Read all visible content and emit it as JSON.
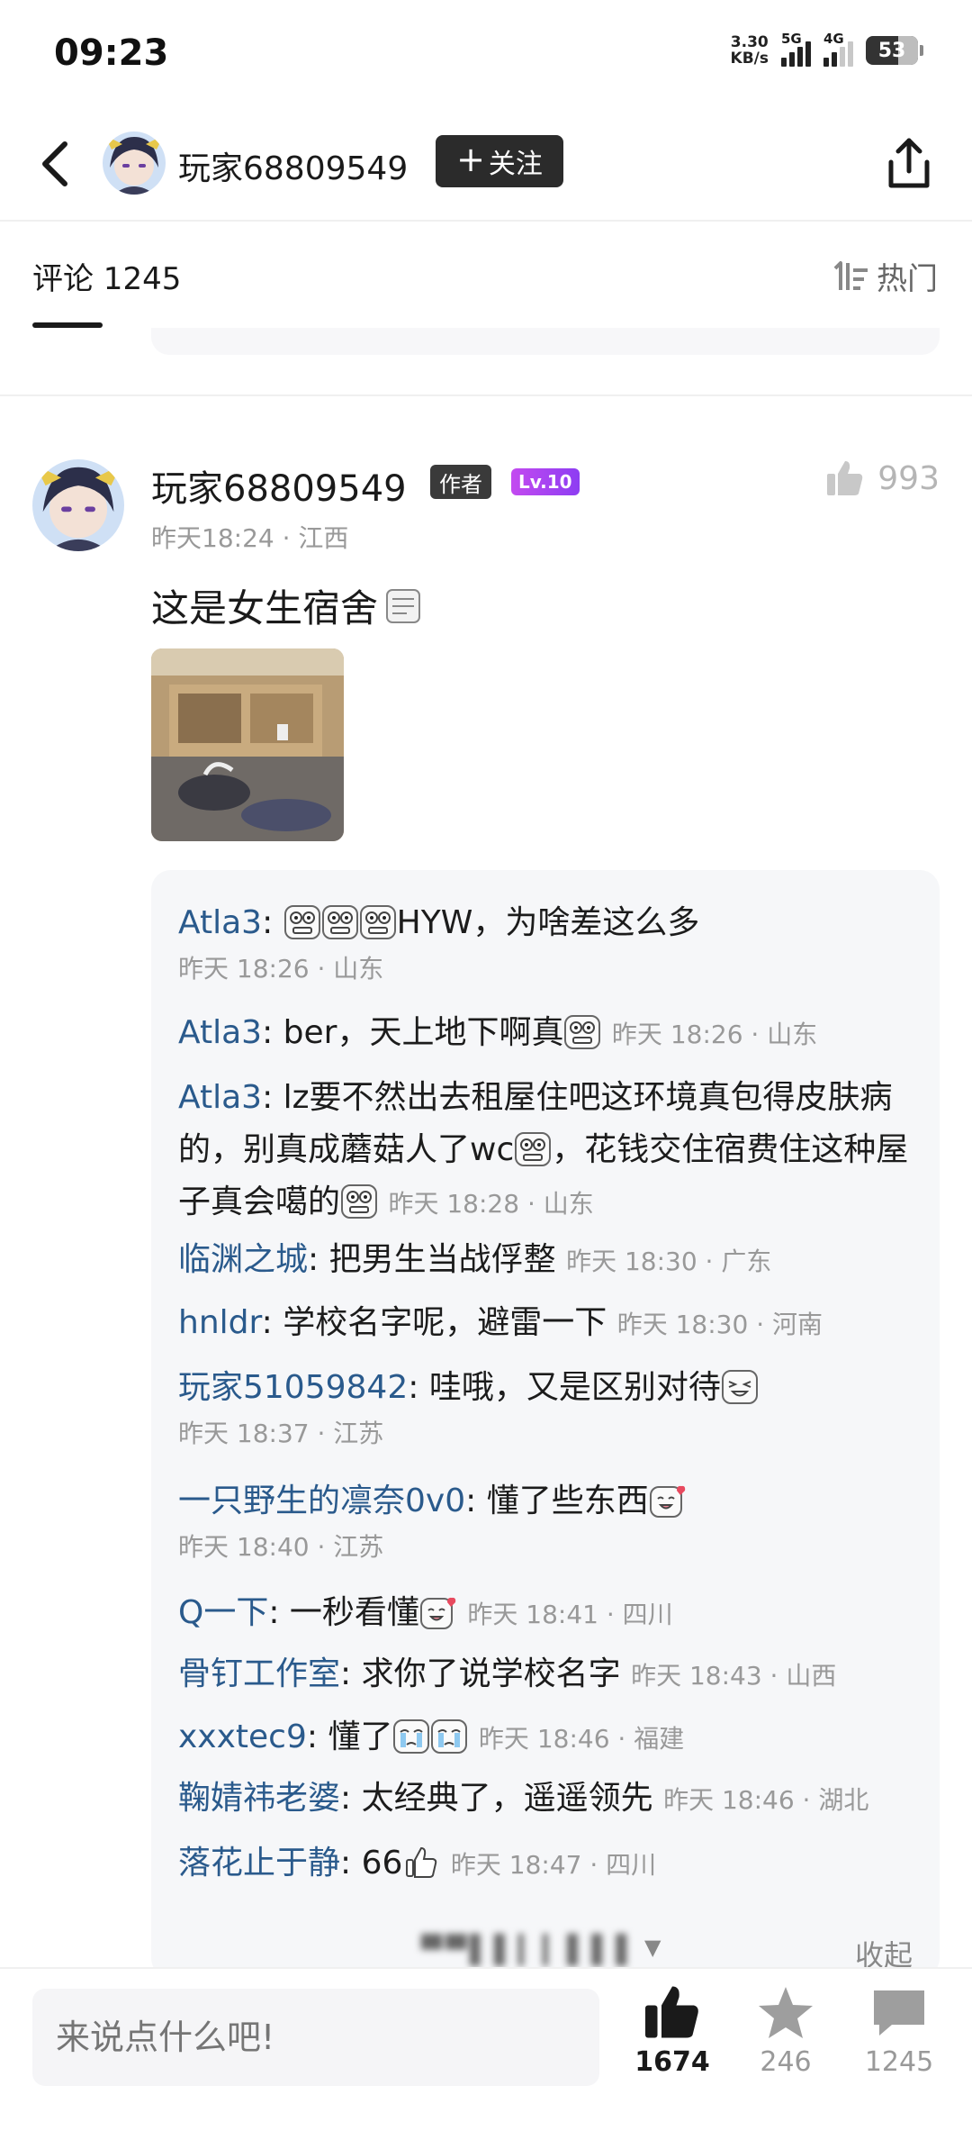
{
  "status_bar": {
    "time": "09:23",
    "net_speed_value": "3.30",
    "net_speed_unit": "KB/s",
    "sim1": "5G",
    "sim2": "4G",
    "battery": "53"
  },
  "header": {
    "username": "玩家68809549",
    "follow_label": "关注"
  },
  "tabs": {
    "comments_label": "评论 1245",
    "sort_label": "热门"
  },
  "comment": {
    "username": "玩家68809549",
    "author_badge": "作者",
    "level_badge": "Lv.10",
    "like_count": "993",
    "meta": "昨天18:24 · 江西",
    "text": "这是女生宿舍"
  },
  "replies": [
    {
      "name": "Atla3",
      "text": "HYW，为啥差这么多",
      "time": "昨天 18:26 · 山东"
    },
    {
      "name": "Atla3",
      "text": "ber，天上地下啊真",
      "time": "昨天 18:26 · 山东"
    },
    {
      "name": "Atla3",
      "text1": "lz要不然出去租屋住吧这环境真包得皮肤病的，别真成蘑菇人了wc",
      "text2": "，花钱交住宿费住这种屋子真会噶的",
      "time": "昨天 18:28 · 山东"
    },
    {
      "name": "临渊之城",
      "text": "把男生当战俘整",
      "time": "昨天 18:30 · 广东"
    },
    {
      "name": "hnldr",
      "text": "学校名字呢，避雷一下",
      "time": "昨天 18:30 · 河南"
    },
    {
      "name": "玩家51059842",
      "text": "哇哦，又是区别对待",
      "time": "昨天 18:37 · 江苏"
    },
    {
      "name": "一只野生的凛奈0v0",
      "text": "懂了些东西",
      "time": "昨天 18:40 · 江苏"
    },
    {
      "name": "Q一下",
      "text": "一秒看懂",
      "time": "昨天 18:41 · 四川"
    },
    {
      "name": "骨钉工作室",
      "text": "求你了说学校名字",
      "time": "昨天 18:43 · 山西"
    },
    {
      "name": "xxxtec9",
      "text": "懂了",
      "time": "昨天 18:46 · 福建"
    },
    {
      "name": "鞠婧祎老婆",
      "text": "太经典了，遥遥领先",
      "time": "昨天 18:46 · 湖北"
    },
    {
      "name": "落花止于静",
      "text": "66",
      "time": "昨天 18:47 · 四川"
    }
  ],
  "collapse": {
    "expand_blur": "▀▀▌▌▎▎▌▌▌",
    "collapse_label": "收起"
  },
  "bottom": {
    "input_placeholder": "来说点什么吧!",
    "like_count": "1674",
    "star_count": "246",
    "comment_count": "1245"
  },
  "colors": {
    "reply_name": "#2a5a8c",
    "level_badge": "#b045f0",
    "author_badge": "#3a3a3a",
    "reply_bg": "#f6f7f9"
  }
}
